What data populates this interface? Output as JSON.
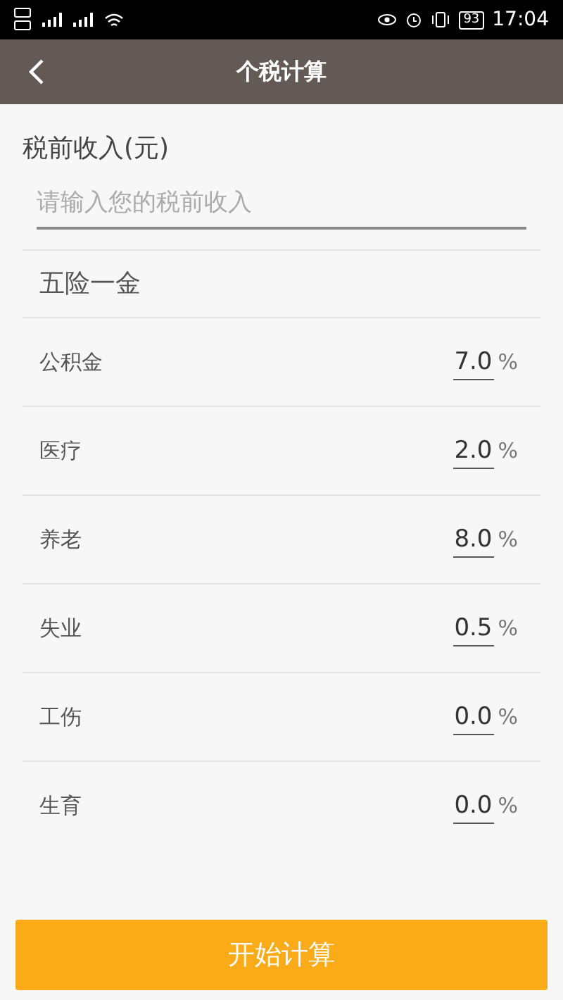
{
  "status_bar": {
    "battery": "93",
    "time": "17:04"
  },
  "nav": {
    "title": "个税计算"
  },
  "income": {
    "label": "税前收入(元)",
    "placeholder": "请输入您的税前收入"
  },
  "section_title": "五险一金",
  "rates": [
    {
      "name": "公积金",
      "value": "7.0",
      "unit": "%"
    },
    {
      "name": "医疗",
      "value": "2.0",
      "unit": "%"
    },
    {
      "name": "养老",
      "value": "8.0",
      "unit": "%"
    },
    {
      "name": "失业",
      "value": "0.5",
      "unit": "%"
    },
    {
      "name": "工伤",
      "value": "0.0",
      "unit": "%"
    },
    {
      "name": "生育",
      "value": "0.0",
      "unit": "%"
    }
  ],
  "button": "开始计算"
}
